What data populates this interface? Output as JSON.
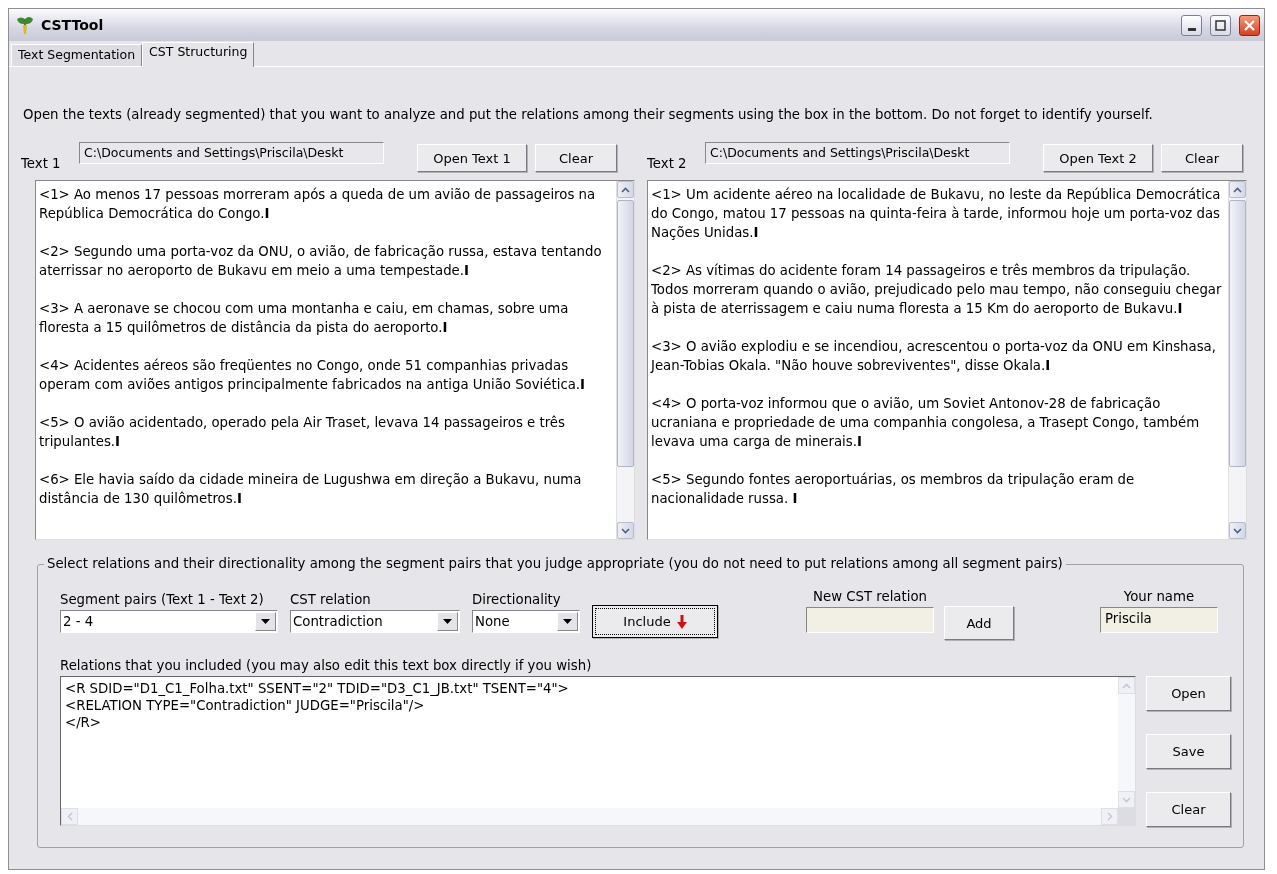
{
  "window": {
    "title": "CSTTool"
  },
  "tabs": [
    {
      "label": "Text Segmentation",
      "selected": false
    },
    {
      "label": "CST Structuring",
      "selected": true
    }
  ],
  "instructions": "Open the texts (already segmented) that you want to analyze and put the relations among their segments using the box in the bottom. Do not forget to identify yourself.",
  "text_panels": [
    {
      "label": "Text 1",
      "path": "C:\\Documents and Settings\\Priscila\\Deskt",
      "open_button": "Open Text 1",
      "clear_button": "Clear",
      "segments": [
        "<1> Ao menos 17 pessoas morreram após a queda de um avião de passageiros na República Democrática do Congo.**I**",
        "<2> Segundo uma porta-voz da ONU, o avião, de fabricação russa, estava tentando aterrissar no aeroporto de Bukavu em meio a uma tempestade.**I**",
        "<3> A aeronave se chocou com uma montanha e caiu, em chamas, sobre uma floresta a 15 quilômetros de distância da pista do aeroporto.**I**",
        "<4> Acidentes aéreos são freqüentes no Congo, onde 51 companhias privadas operam com aviões antigos principalmente fabricados na antiga União Soviética.**I**",
        "<5> O avião acidentado, operado pela Air Traset, levava 14 passageiros e três tripulantes.**I**",
        "<6> Ele havia saído da cidade mineira de Lugushwa em direção a Bukavu, numa distância de 130 quilômetros.**I**"
      ]
    },
    {
      "label": "Text 2",
      "path": "C:\\Documents and Settings\\Priscila\\Deskt",
      "open_button": "Open Text 2",
      "clear_button": "Clear",
      "segments": [
        "<1> Um acidente aéreo na localidade de Bukavu, no leste da República Democrática do Congo, matou 17 pessoas na quinta-feira à tarde, informou hoje um porta-voz das Nações Unidas.**I**",
        "<2> As vítimas do acidente foram 14 passageiros e três membros da tripulação. Todos morreram quando o avião, prejudicado pelo mau tempo, não conseguiu chegar à pista de aterrissagem e caiu numa floresta a 15 Km do aeroporto de Bukavu.**I**",
        "<3> O avião explodiu e se incendiou, acrescentou o porta-voz da ONU em Kinshasa, Jean-Tobias Okala. \"Não houve sobreviventes\", disse Okala.**I**",
        "<4> O porta-voz informou que o avião, um Soviet Antonov-28 de fabricação ucraniana e propriedade de uma companhia congolesa, a Trasept Congo, também levava uma carga de minerais.**I**",
        "<5> Segundo fontes aeroportuárias, os membros da tripulação eram de nacionalidade russa. **I**"
      ]
    }
  ],
  "relations_group": {
    "legend": "Select relations and their directionality among the segment pairs that you judge appropriate (you do not need to put relations among all segment pairs)",
    "segment_pairs": {
      "label": "Segment pairs (Text 1 - Text 2)",
      "value": "2 - 4"
    },
    "cst_relation": {
      "label": "CST relation",
      "value": "Contradiction"
    },
    "directionality": {
      "label": "Directionality",
      "value": "None"
    },
    "include_button": "Include",
    "new_relation": {
      "label": "New CST relation"
    },
    "add_button": "Add",
    "your_name": {
      "label": "Your name",
      "value": "Priscila"
    },
    "relations_label": "Relations that you included (you may also edit this text box directly if you wish)",
    "relations_text": [
      "<R SDID=\"D1_C1_Folha.txt\" SSENT=\"2\" TDID=\"D3_C1_JB.txt\" TSENT=\"4\">",
      "<RELATION TYPE=\"Contradiction\" JUDGE=\"Priscila\"/>",
      "</R>"
    ],
    "buttons": [
      "Open",
      "Save",
      "Clear"
    ]
  }
}
